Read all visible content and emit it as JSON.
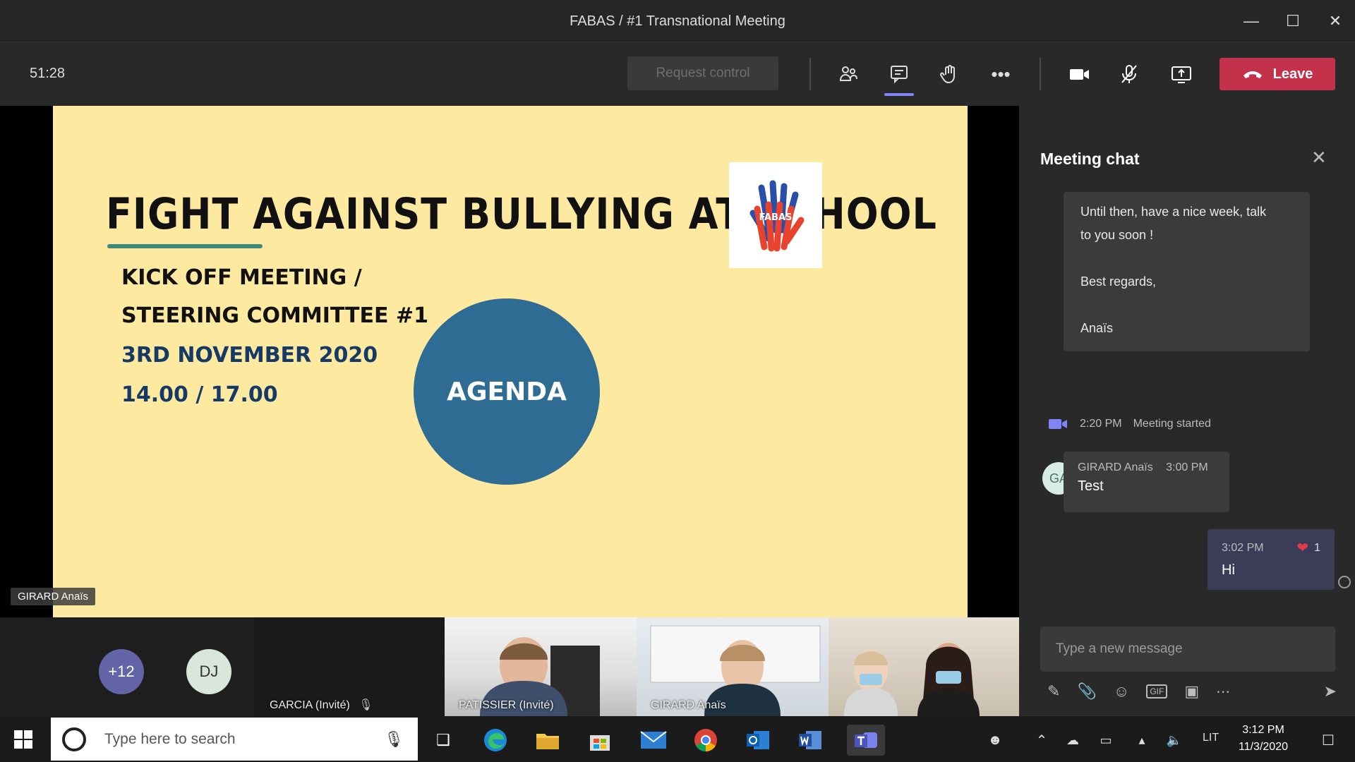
{
  "window": {
    "title": "FABAS / #1 Transnational Meeting"
  },
  "toolbar": {
    "timer": "51:28",
    "request_control": "Request control",
    "leave_label": "Leave"
  },
  "slide": {
    "title": "FIGHT AGAINST BULLYING AT SCHOOL",
    "line1": "KICK OFF MEETING /",
    "line2": "STEERING COMMITTEE #1",
    "date": "3RD NOVEMBER 2020",
    "time": "14.00 / 17.00",
    "agenda": "AGENDA",
    "logo_text": "FABAS"
  },
  "presenter": {
    "name": "GIRARD Anaïs"
  },
  "chat": {
    "title": "Meeting chat",
    "message_top": {
      "line1": "Until then, have a nice week, talk",
      "line2": "to you soon !",
      "line3": "Best regards,",
      "line4": "Anaïs"
    },
    "system": {
      "time": "2:20 PM",
      "text": "Meeting started"
    },
    "msg_ga": {
      "initials": "GA",
      "author": "GIRARD Anaïs",
      "time": "3:00 PM",
      "text": "Test"
    },
    "msg_me": {
      "time": "3:02 PM",
      "reactions": "1",
      "text": "Hi"
    },
    "compose_placeholder": "Type a new message"
  },
  "participants": {
    "overflow": "+12",
    "dj": "DJ",
    "garcia": "GARCIA (Invité)",
    "patissier": "PATISSIER (Invité)",
    "girard": "GIRARD Anaïs"
  },
  "taskbar": {
    "search_placeholder": "Type here to search",
    "lang": "LIT",
    "time": "3:12 PM",
    "date": "11/3/2020"
  },
  "colors": {
    "leave": "#c4314b",
    "slide_bg": "#fde9a0",
    "agenda_circle": "#2f6c93",
    "accent": "#7f85f5"
  }
}
